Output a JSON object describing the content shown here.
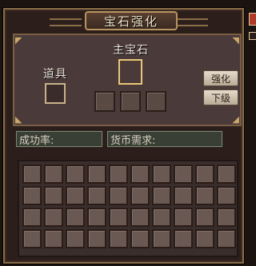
{
  "window": {
    "title": "宝石强化"
  },
  "upper": {
    "main_gem_label": "主宝石",
    "item_label": "道具",
    "enhance_button": "强化",
    "downgrade_button": "下级"
  },
  "info": {
    "success_rate_label": "成功率:",
    "cost_label": "货币需求:"
  },
  "inventory": {
    "rows": 4,
    "cols": 10
  },
  "colors": {
    "frame": "#8a6e48",
    "panel": "#4a3a3a",
    "main_slot_border": "#e8c878",
    "close_button": "#b23a2a"
  }
}
